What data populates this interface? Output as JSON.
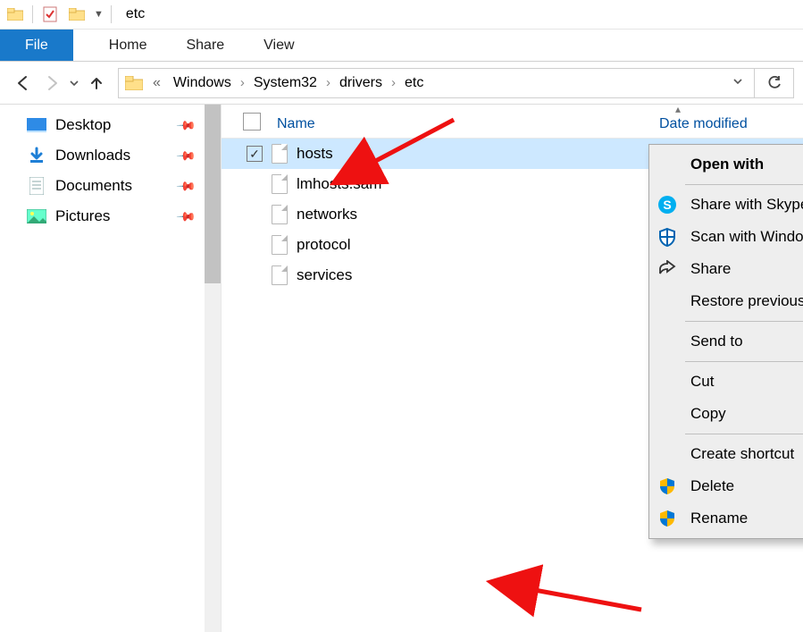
{
  "window": {
    "title": "etc"
  },
  "tabs": {
    "file": "File",
    "home": "Home",
    "share": "Share",
    "view": "View"
  },
  "breadcrumbs": [
    "Windows",
    "System32",
    "drivers",
    "etc"
  ],
  "sidebar": {
    "items": [
      {
        "label": "Desktop"
      },
      {
        "label": "Downloads"
      },
      {
        "label": "Documents"
      },
      {
        "label": "Pictures"
      }
    ]
  },
  "columns": {
    "name": "Name",
    "date": "Date modified"
  },
  "files": [
    {
      "name": "hosts",
      "selected": true
    },
    {
      "name": "lmhosts.sam",
      "selected": false
    },
    {
      "name": "networks",
      "selected": false
    },
    {
      "name": "protocol",
      "selected": false
    },
    {
      "name": "services",
      "selected": false
    }
  ],
  "context_menu": {
    "open_with": "Open with",
    "share_skype": "Share with Skype",
    "scan_defender": "Scan with Windows Defender...",
    "share": "Share",
    "restore": "Restore previous versions",
    "send_to": "Send to",
    "cut": "Cut",
    "copy": "Copy",
    "create_shortcut": "Create shortcut",
    "delete": "Delete",
    "rename": "Rename"
  }
}
